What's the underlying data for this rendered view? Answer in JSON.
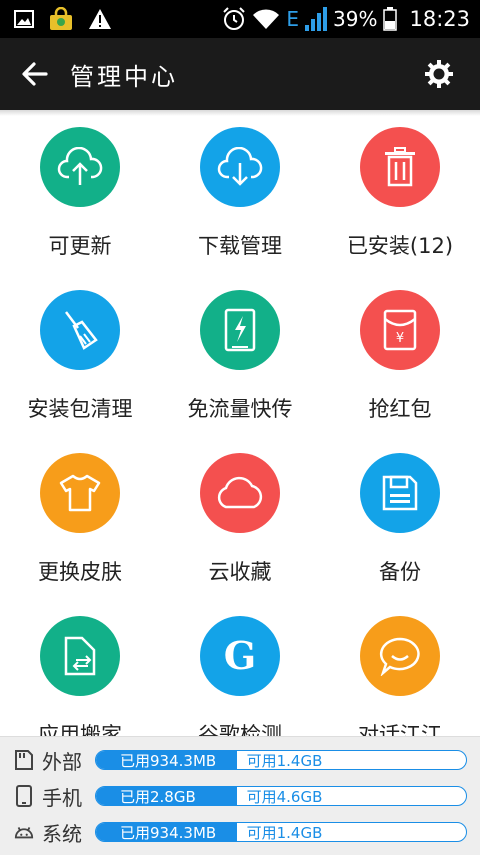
{
  "status_bar": {
    "network": "E",
    "battery": "39%",
    "time": "18:23"
  },
  "app_bar": {
    "title": "管理中心"
  },
  "grid": [
    {
      "label": "可更新",
      "icon": "cloud-upload-icon",
      "color": "#12b089"
    },
    {
      "label": "下载管理",
      "icon": "cloud-download-icon",
      "color": "#13a3e8"
    },
    {
      "label": "已安装(12)",
      "icon": "trash-icon",
      "color": "#f4504f"
    },
    {
      "label": "安装包清理",
      "icon": "broom-icon",
      "color": "#13a3e8"
    },
    {
      "label": "免流量快传",
      "icon": "phone-flash-icon",
      "color": "#12b089"
    },
    {
      "label": "抢红包",
      "icon": "red-envelope-icon",
      "color": "#f4504f"
    },
    {
      "label": "更换皮肤",
      "icon": "tshirt-icon",
      "color": "#f79d1a"
    },
    {
      "label": "云收藏",
      "icon": "cloud-icon",
      "color": "#f4504f"
    },
    {
      "label": "备份",
      "icon": "floppy-icon",
      "color": "#13a3e8"
    },
    {
      "label": "应用搬家",
      "icon": "move-app-icon",
      "color": "#12b089"
    },
    {
      "label": "谷歌检测",
      "icon": "google-g-icon",
      "color": "#13a3e8"
    },
    {
      "label": "对话江江",
      "icon": "chat-bubble-icon",
      "color": "#f79d1a"
    }
  ],
  "storage": [
    {
      "name": "外部",
      "icon": "sd-card-icon",
      "used": "已用934.3MB",
      "free": "可用1.4GB",
      "used_fraction": 0.38
    },
    {
      "name": "手机",
      "icon": "phone-icon",
      "used": "已用2.8GB",
      "free": "可用4.6GB",
      "used_fraction": 0.38
    },
    {
      "name": "系统",
      "icon": "android-icon",
      "used": "已用934.3MB",
      "free": "可用1.4GB",
      "used_fraction": 0.38
    }
  ],
  "colors": {
    "accent": "#1a8ee6",
    "appbar": "#1b1b1b"
  }
}
